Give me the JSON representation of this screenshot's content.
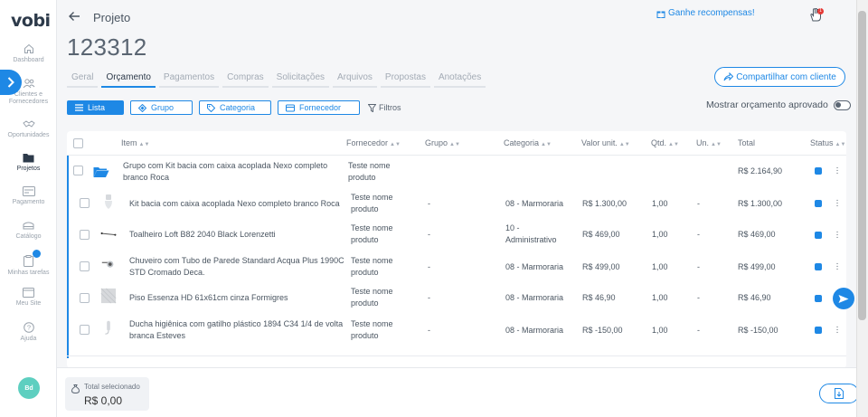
{
  "sidebar": {
    "logo": "vobi",
    "items": [
      {
        "label": "Dashboard",
        "icon": "home-icon"
      },
      {
        "label": "Clientes e Fornecedores",
        "icon": "users-icon"
      },
      {
        "label": "Oportunidades",
        "icon": "handshake-icon"
      },
      {
        "label": "Projetos",
        "icon": "folder-icon"
      },
      {
        "label": "Pagamento",
        "icon": "payment-icon"
      },
      {
        "label": "Catálogo",
        "icon": "catalog-icon"
      },
      {
        "label": "Minhas tarefas",
        "icon": "clipboard-icon"
      },
      {
        "label": "Meu Site",
        "icon": "website-icon"
      },
      {
        "label": "Ajuda",
        "icon": "help-icon"
      }
    ],
    "avatar": "Bd"
  },
  "header": {
    "breadcrumb": "Projeto",
    "title": "123312",
    "rewards": "Ganhe recompensas!",
    "notification_count": "1"
  },
  "tabs": [
    "Geral",
    "Orçamento",
    "Pagamentos",
    "Compras",
    "Solicitações",
    "Arquivos",
    "Propostas",
    "Anotações"
  ],
  "share_button": "Compartilhar com cliente",
  "filters": {
    "lista": "Lista",
    "grupo": "Grupo",
    "categoria": "Categoria",
    "fornecedor": "Fornecedor",
    "filtros": "Filtros"
  },
  "show_approved": "Mostrar orçamento aprovado",
  "table": {
    "headers": [
      "Item",
      "Fornecedor",
      "Grupo",
      "Categoria",
      "Valor unit.",
      "Qtd.",
      "Un.",
      "Total",
      "Status"
    ],
    "group_row": {
      "item": "Grupo com Kit bacia com caixa acoplada Nexo completo branco Roca",
      "fornecedor": "Teste nome produto",
      "total": "R$ 2.164,90"
    },
    "rows": [
      {
        "item": "Kit bacia com caixa acoplada Nexo completo branco Roca",
        "fornecedor": "Teste nome produto",
        "grupo": "-",
        "categoria": "08 - Marmoraria",
        "valor": "R$ 1.300,00",
        "qtd": "1,00",
        "un": "-",
        "total": "R$ 1.300,00"
      },
      {
        "item": "Toalheiro Loft B82 2040 Black Lorenzetti",
        "fornecedor": "Teste nome produto",
        "grupo": "-",
        "categoria": "10 - Administrativo",
        "valor": "R$ 469,00",
        "qtd": "1,00",
        "un": "-",
        "total": "R$ 469,00"
      },
      {
        "item": "Chuveiro com Tubo de Parede Standard Acqua Plus 1990C STD Cromado Deca.",
        "fornecedor": "Teste nome produto",
        "grupo": "-",
        "categoria": "08 - Marmoraria",
        "valor": "R$ 499,00",
        "qtd": "1,00",
        "un": "-",
        "total": "R$ 499,00"
      },
      {
        "item": "Piso Essenza HD 61x61cm cinza Formigres",
        "fornecedor": "Teste nome produto",
        "grupo": "-",
        "categoria": "08 - Marmoraria",
        "valor": "R$ 46,90",
        "qtd": "1,00",
        "un": "-",
        "total": "R$ 46,90"
      },
      {
        "item": "Ducha higiênica com gatilho plástico 1894 C34 1/4 de volta branca Esteves",
        "fornecedor": "Teste nome produto",
        "grupo": "-",
        "categoria": "08 - Marmoraria",
        "valor": "R$ -150,00",
        "qtd": "1,00",
        "un": "-",
        "total": "R$ -150,00"
      }
    ]
  },
  "footer": {
    "total_label": "Total selecionado",
    "total_value": "R$ 0,00"
  },
  "colors": {
    "accent": "#1e88e5",
    "notification": "#e53935",
    "avatar": "#5ecfc0"
  }
}
